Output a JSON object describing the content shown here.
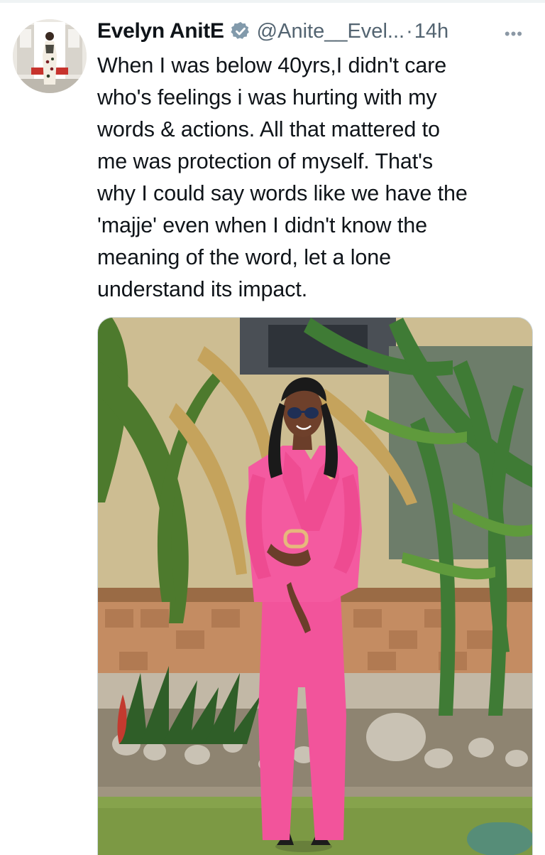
{
  "author": {
    "display_name": "Evelyn AnitE",
    "handle": "@Anite__Evel...",
    "separator": "·",
    "timestamp": "14h",
    "verified_badge_color": "#829aab",
    "avatar_icon": "profile-photo"
  },
  "tweet": {
    "text": "When I was below 40yrs,I didn't care\nwho's feelings i was hurting with my\nwords & actions. All that mattered to\nme was protection of myself. That's\nwhy I could say words like we have the\n'majje' even when I didn't know the\nmeaning of the word, let a lone\nunderstand its impact."
  },
  "media": {
    "icon": "attached-photo",
    "accent_color": "#f2549b"
  },
  "more_icon": "more-options-icon"
}
